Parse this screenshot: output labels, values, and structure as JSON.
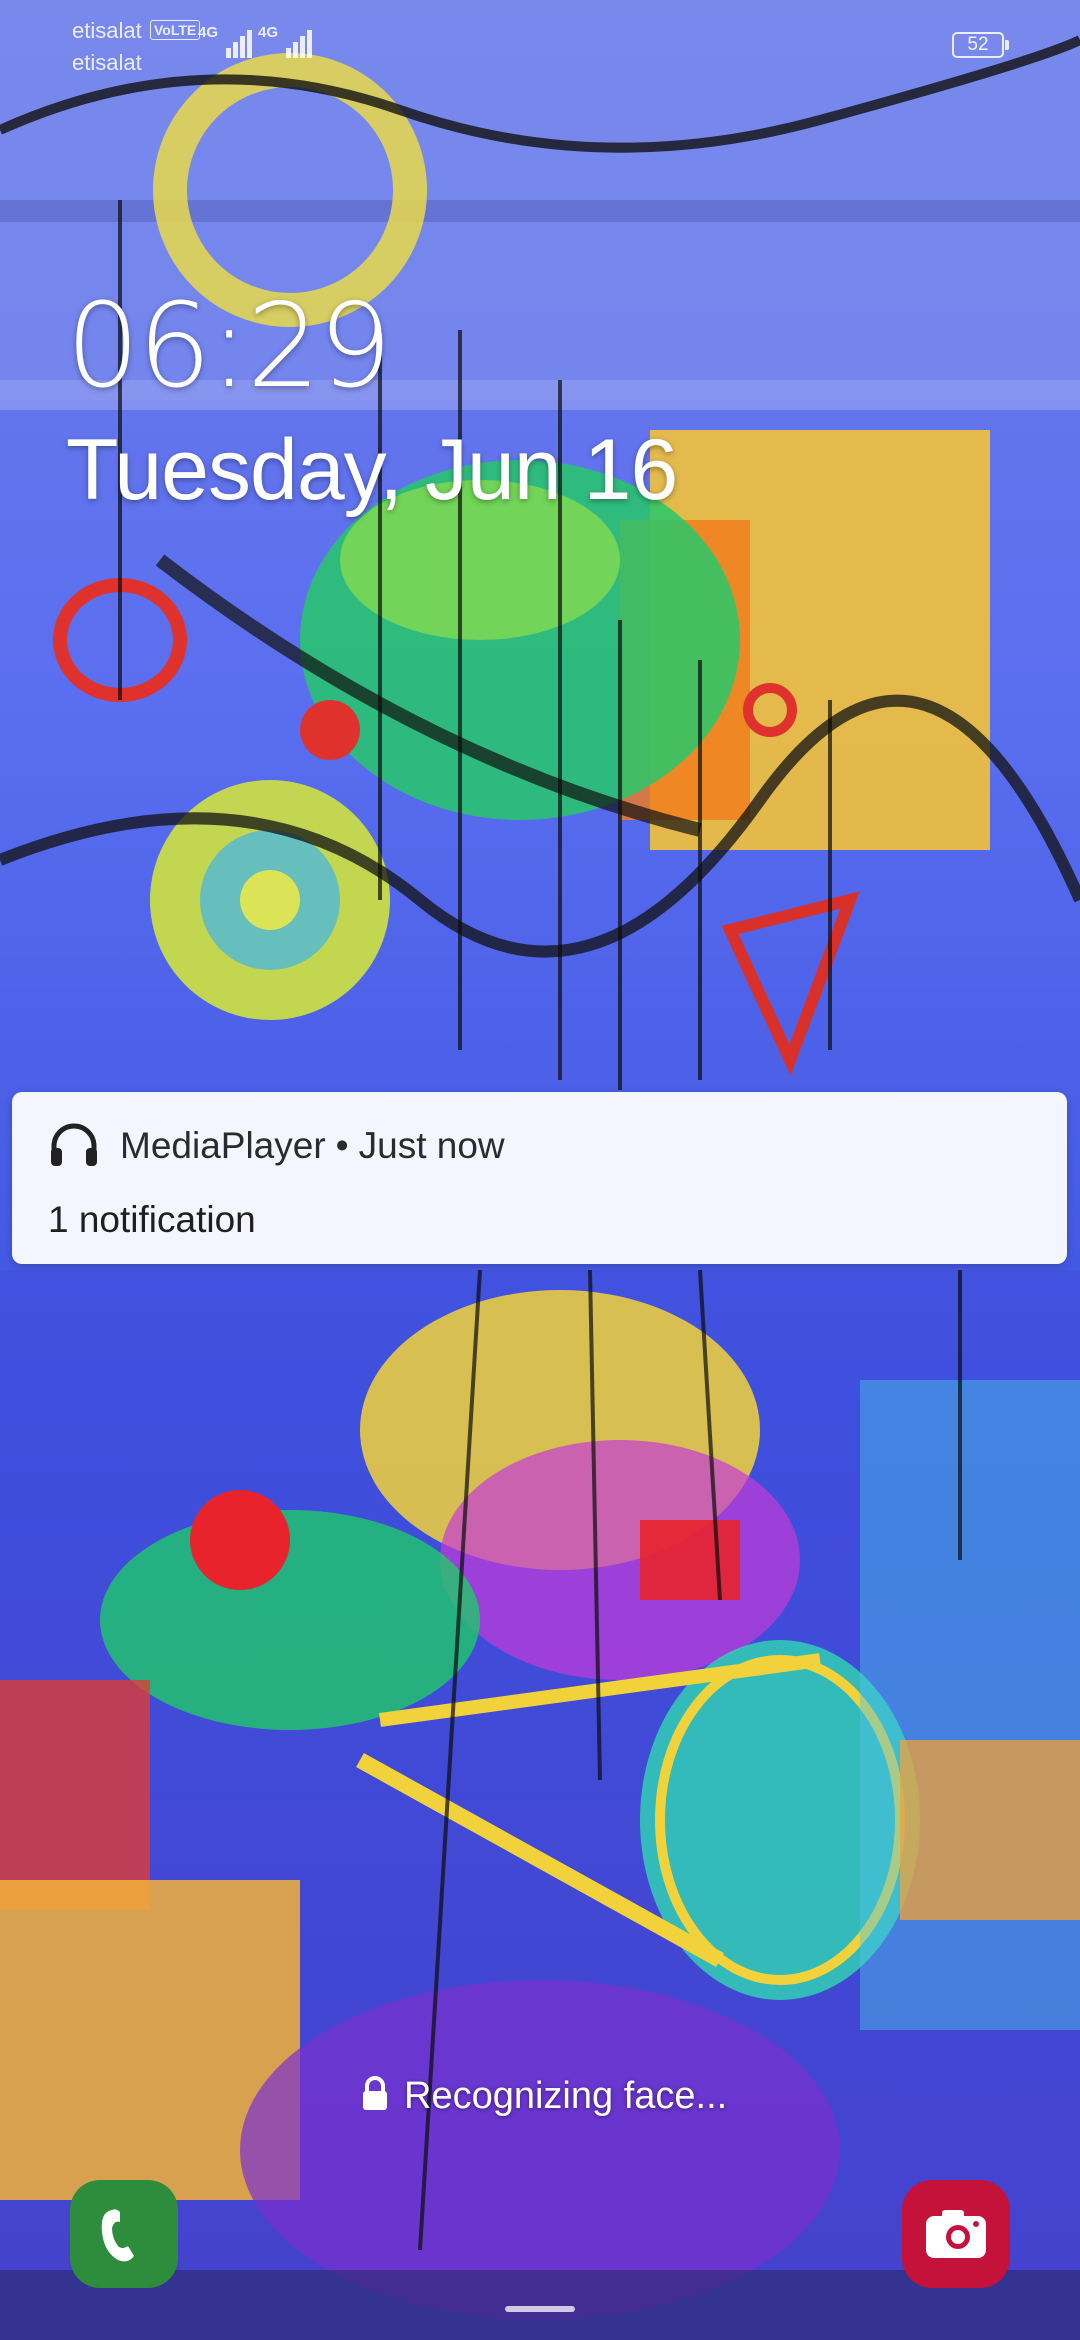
{
  "status_bar": {
    "carrier_primary": "etisalat",
    "carrier_secondary": "etisalat",
    "volte_badge": "VoLTE",
    "network_1": "4G",
    "network_2": "4G",
    "battery_level": "52",
    "signal_icon": "signal-bars-icon"
  },
  "lockscreen": {
    "time": "06:29",
    "date": "Tuesday, Jun 16"
  },
  "notification": {
    "app_icon": "headphones-icon",
    "app_name": "MediaPlayer",
    "separator": "•",
    "time": "Just now",
    "body": "1 notification"
  },
  "face_unlock": {
    "icon": "lock-icon",
    "status_text": "Recognizing face..."
  },
  "shortcuts": {
    "left_icon": "phone-icon",
    "left_color": "#2e8d3c",
    "right_icon": "camera-icon",
    "right_color": "#c4123b"
  }
}
